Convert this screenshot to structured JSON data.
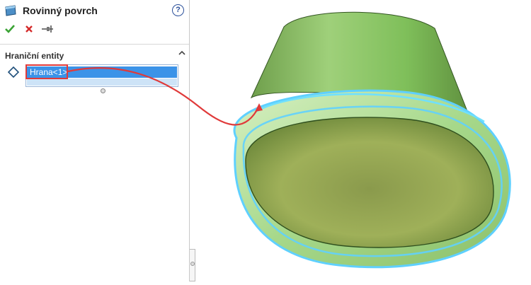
{
  "panel": {
    "title": "Rovinný povrch",
    "help_glyph": "?",
    "actions": [
      {
        "name": "confirm",
        "icon": "check-icon",
        "color": "#3aa334"
      },
      {
        "name": "cancel",
        "icon": "close-icon",
        "color": "#d52b2b"
      },
      {
        "name": "pin",
        "icon": "pin-icon",
        "color": "#555555"
      }
    ],
    "section": {
      "title": "Hraniční entity",
      "selected_entity": "Hrana<1>"
    }
  },
  "colors": {
    "selection": "#3b93e8",
    "callout": "#e03a3a",
    "model_green": "#7fbf5a",
    "edge_highlight": "#5fd0ff"
  }
}
